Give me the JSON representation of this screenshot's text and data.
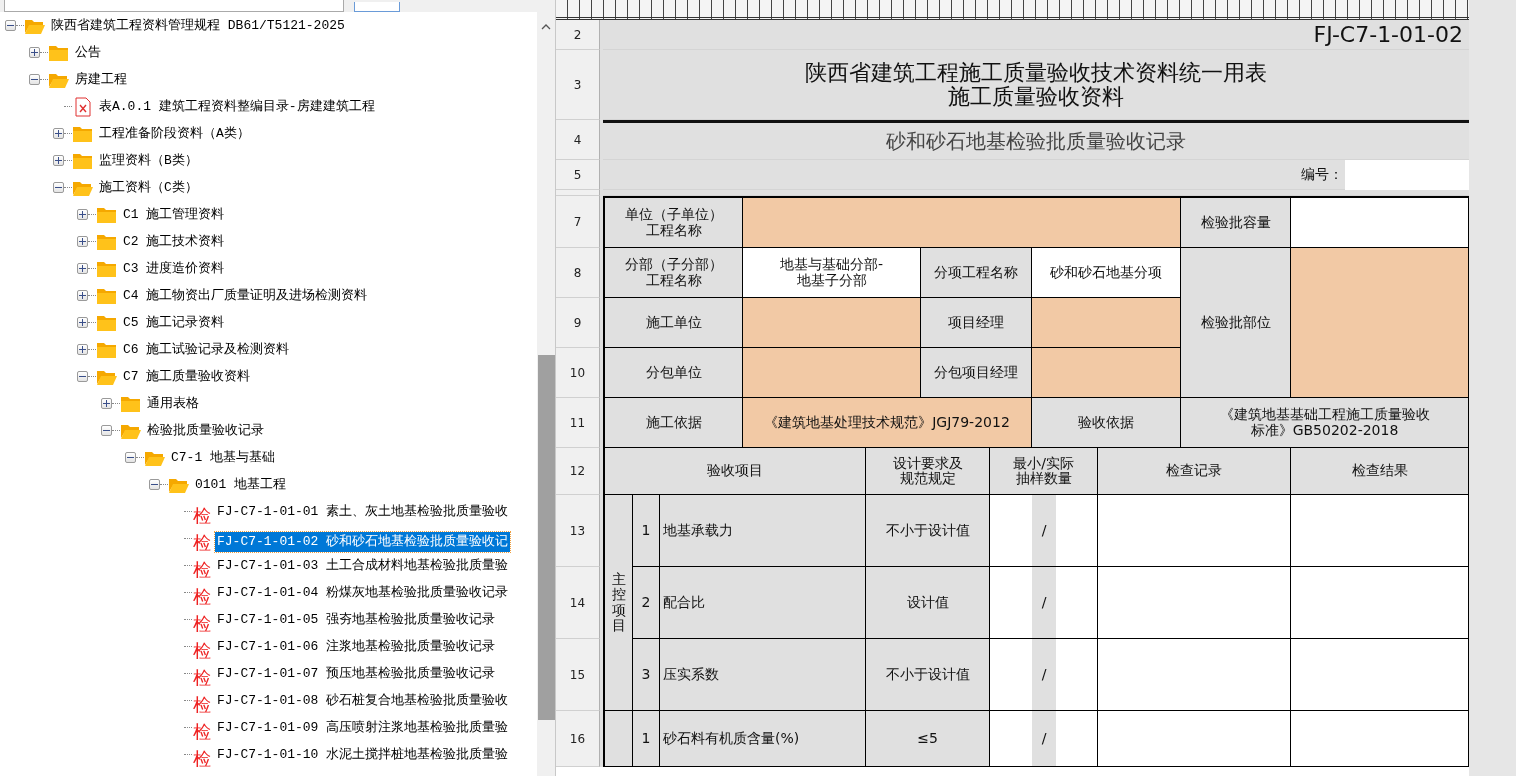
{
  "tree": [
    {
      "label": "陕西省建筑工程资料管理规程 DB61/T5121-2025",
      "kind": "folder",
      "expanded": true,
      "selected": false,
      "children": [
        {
          "label": "公告",
          "kind": "folder",
          "expanded": false,
          "selected": false
        },
        {
          "label": "房建工程",
          "kind": "folder",
          "expanded": true,
          "selected": false,
          "children": [
            {
              "label": "表A.0.1 建筑工程资料整编目录-房建建筑工程",
              "kind": "file",
              "selected": false
            },
            {
              "label": "工程准备阶段资料（A类）",
              "kind": "folder",
              "expanded": false,
              "selected": false
            },
            {
              "label": "监理资料（B类）",
              "kind": "folder",
              "expanded": false,
              "selected": false
            },
            {
              "label": "施工资料（C类）",
              "kind": "folder",
              "expanded": true,
              "selected": false,
              "children": [
                {
                  "label": "C1 施工管理资料",
                  "kind": "folder",
                  "expanded": false,
                  "selected": false
                },
                {
                  "label": "C2 施工技术资料",
                  "kind": "folder",
                  "expanded": false,
                  "selected": false
                },
                {
                  "label": "C3 进度造价资料",
                  "kind": "folder",
                  "expanded": false,
                  "selected": false
                },
                {
                  "label": "C4 施工物资出厂质量证明及进场检测资料",
                  "kind": "folder",
                  "expanded": false,
                  "selected": false
                },
                {
                  "label": "C5 施工记录资料",
                  "kind": "folder",
                  "expanded": false,
                  "selected": false
                },
                {
                  "label": "C6 施工试验记录及检测资料",
                  "kind": "folder",
                  "expanded": false,
                  "selected": false
                },
                {
                  "label": "C7 施工质量验收资料",
                  "kind": "folder",
                  "expanded": true,
                  "selected": false,
                  "children": [
                    {
                      "label": "通用表格",
                      "kind": "folder",
                      "expanded": false,
                      "selected": false
                    },
                    {
                      "label": "检验批质量验收记录",
                      "kind": "folder",
                      "expanded": true,
                      "selected": false,
                      "children": [
                        {
                          "label": "C7-1 地基与基础",
                          "kind": "folder",
                          "expanded": true,
                          "selected": false,
                          "children": [
                            {
                              "label": "0101 地基工程",
                              "kind": "folder",
                              "expanded": true,
                              "selected": false,
                              "children": [
                                {
                                  "label": "FJ-C7-1-01-01 素土、灰土地基检验批质量验收",
                                  "kind": "check",
                                  "mark": "检",
                                  "selected": false
                                },
                                {
                                  "label": "FJ-C7-1-01-02 砂和砂石地基检验批质量验收记",
                                  "kind": "check",
                                  "mark": "检",
                                  "selected": true
                                },
                                {
                                  "label": "FJ-C7-1-01-03 土工合成材料地基检验批质量验",
                                  "kind": "check",
                                  "mark": "检",
                                  "selected": false
                                },
                                {
                                  "label": "FJ-C7-1-01-04 粉煤灰地基检验批质量验收记录",
                                  "kind": "check",
                                  "mark": "检",
                                  "selected": false
                                },
                                {
                                  "label": "FJ-C7-1-01-05 强夯地基检验批质量验收记录",
                                  "kind": "check",
                                  "mark": "检",
                                  "selected": false
                                },
                                {
                                  "label": "FJ-C7-1-01-06 注浆地基检验批质量验收记录",
                                  "kind": "check",
                                  "mark": "检",
                                  "selected": false
                                },
                                {
                                  "label": "FJ-C7-1-01-07 预压地基检验批质量验收记录",
                                  "kind": "check",
                                  "mark": "检",
                                  "selected": false
                                },
                                {
                                  "label": "FJ-C7-1-01-08 砂石桩复合地基检验批质量验收",
                                  "kind": "check",
                                  "mark": "检",
                                  "selected": false
                                },
                                {
                                  "label": "FJ-C7-1-01-09 高压喷射注浆地基检验批质量验",
                                  "kind": "check",
                                  "mark": "检",
                                  "selected": false
                                },
                                {
                                  "label": "FJ-C7-1-01-10 水泥土搅拌桩地基检验批质量验",
                                  "kind": "check",
                                  "mark": "检",
                                  "selected": false
                                }
                              ]
                            }
                          ]
                        }
                      ]
                    }
                  ]
                }
              ]
            }
          ]
        }
      ]
    }
  ],
  "sheet": {
    "row_numbers": [
      "2",
      "3",
      "4",
      "5",
      "7",
      "8",
      "9",
      "10",
      "11",
      "12",
      "13",
      "14",
      "15",
      "16"
    ],
    "form_code": "FJ-C7-1-01-02",
    "title_lines": [
      "陕西省建筑工程施工质量验收技术资料统一用表",
      "施工质量验收资料"
    ],
    "subtitle": "砂和砂石地基检验批质量验收记录",
    "number_label": "编号：",
    "cells": [
      {
        "kind": "label",
        "lines": [
          "单位（子单位）",
          "工程名称"
        ]
      },
      {
        "kind": "field"
      },
      {
        "kind": "label",
        "lines": [
          "检验批容量"
        ]
      },
      {
        "kind": "blank"
      },
      {
        "kind": "label",
        "lines": [
          "分部（子分部）",
          "工程名称"
        ]
      },
      {
        "kind": "value",
        "lines": [
          "地基与基础分部-",
          "地基子分部"
        ]
      },
      {
        "kind": "label",
        "lines": [
          "分项工程名称"
        ]
      },
      {
        "kind": "value",
        "lines": [
          "砂和砂石地基分项"
        ]
      },
      {
        "kind": "label",
        "lines": [
          "施工单位"
        ]
      },
      {
        "kind": "field"
      },
      {
        "kind": "label",
        "lines": [
          "项目经理"
        ]
      },
      {
        "kind": "field"
      },
      {
        "kind": "label",
        "lines": [
          "检验批部位"
        ]
      },
      {
        "kind": "field"
      },
      {
        "kind": "label",
        "lines": [
          "分包单位"
        ]
      },
      {
        "kind": "field"
      },
      {
        "kind": "label",
        "lines": [
          "分包项目经理"
        ]
      },
      {
        "kind": "field"
      },
      {
        "kind": "label",
        "lines": [
          "施工依据"
        ]
      },
      {
        "kind": "field",
        "lines": [
          "《建筑地基处理技术规范》JGJ79-2012"
        ]
      },
      {
        "kind": "label",
        "lines": [
          "验收依据"
        ]
      },
      {
        "kind": "label",
        "lines": [
          "《建筑地基基础工程施工质量验收",
          "标准》GB50202-2018"
        ]
      },
      {
        "kind": "label",
        "lines": [
          "验收项目"
        ]
      },
      {
        "kind": "label",
        "lines": [
          "设计要求及",
          "规范规定"
        ]
      },
      {
        "kind": "label",
        "lines": [
          "最小/实际",
          "抽样数量"
        ]
      },
      {
        "kind": "label",
        "lines": [
          "检查记录"
        ]
      },
      {
        "kind": "label",
        "lines": [
          "检查结果"
        ]
      }
    ],
    "groups": [
      {
        "label": "主控项目",
        "items": [
          {
            "no": "1",
            "name": "地基承载力",
            "requirement": "不小于设计值",
            "slash": "/"
          },
          {
            "no": "2",
            "name": "配合比",
            "requirement": "设计值",
            "slash": "/"
          },
          {
            "no": "3",
            "name": "压实系数",
            "requirement": "不小于设计值",
            "slash": "/"
          }
        ]
      },
      {
        "items": [
          {
            "no": "1",
            "name": "砂石料有机质含量(%)",
            "requirement": "≤5",
            "slash": "/"
          }
        ]
      }
    ]
  }
}
